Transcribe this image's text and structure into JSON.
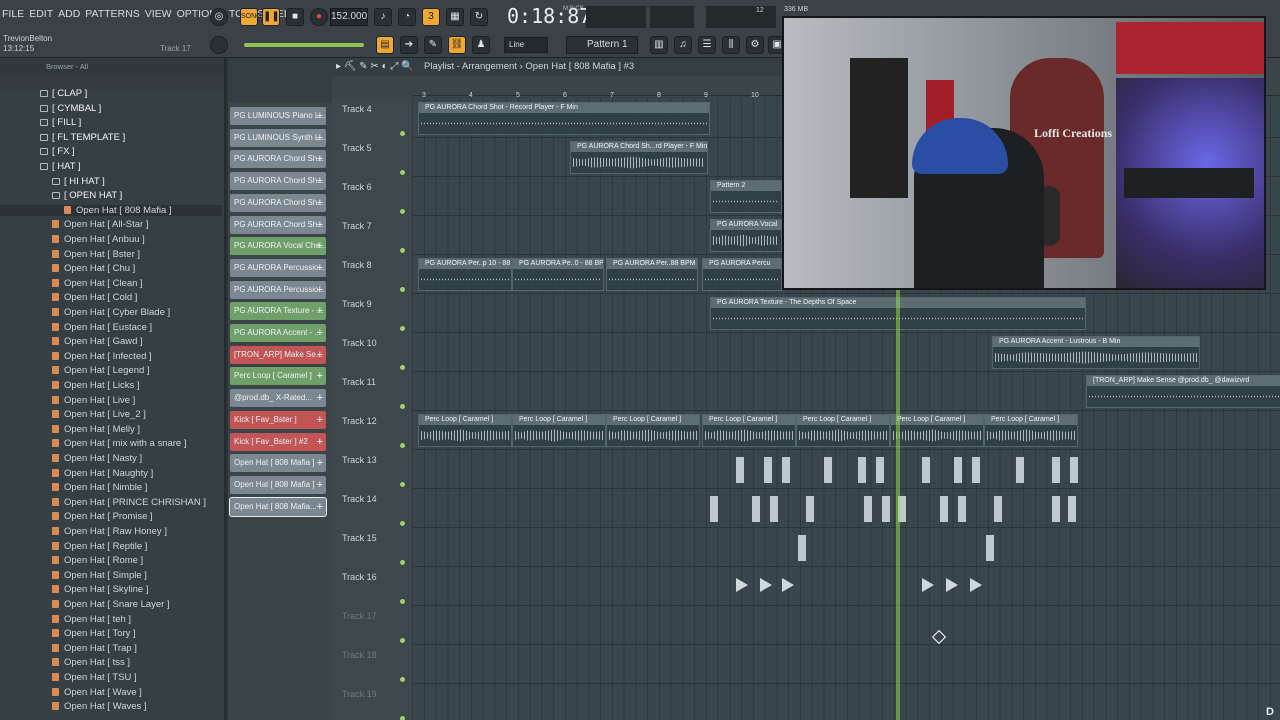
{
  "menu": [
    "FILE",
    "EDIT",
    "ADD",
    "PATTERNS",
    "VIEW",
    "OPTIONS",
    "TOOLS",
    "HELP"
  ],
  "transport": {
    "bpm": "152.000",
    "time": "0:18:87",
    "time_label": "M:S:CS",
    "pattern": "Pattern 1",
    "snap": "Line",
    "memory": "336 MB",
    "cpu": "12"
  },
  "song_info": {
    "user": "TrevionBelton",
    "clock": "13:12:15",
    "track": "Track 17"
  },
  "browser": {
    "title": "Browser - All",
    "items": [
      {
        "label": "[ CLAP ]",
        "kind": "folder",
        "indent": 1
      },
      {
        "label": "[ CYMBAL ]",
        "kind": "folder",
        "indent": 1
      },
      {
        "label": "[ FILL ]",
        "kind": "folder",
        "indent": 1
      },
      {
        "label": "[ FL TEMPLATE ]",
        "kind": "folder",
        "indent": 1
      },
      {
        "label": "[ FX ]",
        "kind": "folder",
        "indent": 1
      },
      {
        "label": "[ HAT ]",
        "kind": "folder",
        "indent": 1
      },
      {
        "label": "[ HI HAT ]",
        "kind": "folder",
        "indent": 2
      },
      {
        "label": "[ OPEN HAT ]",
        "kind": "folder",
        "indent": 2
      },
      {
        "label": "Open Hat [ 808 Mafia ]",
        "kind": "file",
        "indent": 3
      },
      {
        "label": "Open Hat [ All-Star ]",
        "kind": "file",
        "indent": 2
      },
      {
        "label": "Open Hat [ Anbuu ]",
        "kind": "file",
        "indent": 2
      },
      {
        "label": "Open Hat [ Bster ]",
        "kind": "file",
        "indent": 2
      },
      {
        "label": "Open Hat [ Chu ]",
        "kind": "file",
        "indent": 2
      },
      {
        "label": "Open Hat [ Clean ]",
        "kind": "file",
        "indent": 2
      },
      {
        "label": "Open Hat [ Cold ]",
        "kind": "file",
        "indent": 2
      },
      {
        "label": "Open Hat [ Cyber Blade ]",
        "kind": "file",
        "indent": 2
      },
      {
        "label": "Open Hat [ Eustace ]",
        "kind": "file",
        "indent": 2
      },
      {
        "label": "Open Hat [ Gawd ]",
        "kind": "file",
        "indent": 2
      },
      {
        "label": "Open Hat [ Infected ]",
        "kind": "file",
        "indent": 2
      },
      {
        "label": "Open Hat [ Legend ]",
        "kind": "file",
        "indent": 2
      },
      {
        "label": "Open Hat [ Licks ]",
        "kind": "file",
        "indent": 2
      },
      {
        "label": "Open Hat [ Live ]",
        "kind": "file",
        "indent": 2
      },
      {
        "label": "Open Hat [ Live_2 ]",
        "kind": "file",
        "indent": 2
      },
      {
        "label": "Open Hat [ Melly ]",
        "kind": "file",
        "indent": 2
      },
      {
        "label": "Open Hat [ mix with a snare ]",
        "kind": "file",
        "indent": 2
      },
      {
        "label": "Open Hat [ Nasty ]",
        "kind": "file",
        "indent": 2
      },
      {
        "label": "Open Hat [ Naughty ]",
        "kind": "file",
        "indent": 2
      },
      {
        "label": "Open Hat [ Nimble ]",
        "kind": "file",
        "indent": 2
      },
      {
        "label": "Open Hat [ PRINCE CHRISHAN ]",
        "kind": "file",
        "indent": 2
      },
      {
        "label": "Open Hat [ Promise ]",
        "kind": "file",
        "indent": 2
      },
      {
        "label": "Open Hat [ Raw Honey ]",
        "kind": "file",
        "indent": 2
      },
      {
        "label": "Open Hat [ Reptile ]",
        "kind": "file",
        "indent": 2
      },
      {
        "label": "Open Hat [ Rome ]",
        "kind": "file",
        "indent": 2
      },
      {
        "label": "Open Hat [ Simple ]",
        "kind": "file",
        "indent": 2
      },
      {
        "label": "Open Hat [ Skyline ]",
        "kind": "file",
        "indent": 2
      },
      {
        "label": "Open Hat [ Snare Layer ]",
        "kind": "file",
        "indent": 2
      },
      {
        "label": "Open Hat [ teh ]",
        "kind": "file",
        "indent": 2
      },
      {
        "label": "Open Hat [ Tory ]",
        "kind": "file",
        "indent": 2
      },
      {
        "label": "Open Hat [ Trap ]",
        "kind": "file",
        "indent": 2
      },
      {
        "label": "Open Hat [ tss ]",
        "kind": "file",
        "indent": 2
      },
      {
        "label": "Open Hat [ TSU ]",
        "kind": "file",
        "indent": 2
      },
      {
        "label": "Open Hat [ Wave ]",
        "kind": "file",
        "indent": 2
      },
      {
        "label": "Open Hat [ Waves ]",
        "kind": "file",
        "indent": 2
      }
    ]
  },
  "channels": [
    {
      "label": "PG LUMINOUS Piano L...",
      "color": "grey"
    },
    {
      "label": "PG LUMINOUS Synth L...",
      "color": "grey"
    },
    {
      "label": "PG AURORA Chord Sh...",
      "color": "grey"
    },
    {
      "label": "PG AURORA Chord Sh...",
      "color": "grey"
    },
    {
      "label": "PG AURORA Chord Sh...",
      "color": "grey"
    },
    {
      "label": "PG AURORA Chord Sh...",
      "color": "grey"
    },
    {
      "label": "PG AURORA Vocal Cho...",
      "color": "green"
    },
    {
      "label": "PG AURORA Percussio...",
      "color": "grey"
    },
    {
      "label": "PG AURORA Percussio...",
      "color": "grey"
    },
    {
      "label": "PG AURORA Texture - ...",
      "color": "green"
    },
    {
      "label": "PG AURORA Accent - ...",
      "color": "green"
    },
    {
      "label": "[TRON_ARP] Make Se...",
      "color": "red"
    },
    {
      "label": "Perc Loop [ Caramel ]",
      "color": "green"
    },
    {
      "label": "@prod.db_ X-Rated...",
      "color": "grey"
    },
    {
      "label": "Kick [ Fav_Bster ]",
      "color": "red"
    },
    {
      "label": "Kick [ Fav_Bster ] #2",
      "color": "red"
    },
    {
      "label": "Open Hat [ 808 Mafia ]",
      "color": "grey"
    },
    {
      "label": "Open Hat [ 808 Mafia ]",
      "color": "grey"
    },
    {
      "label": "Open Hat [ 808 Mafia...",
      "color": "grey",
      "selected": true
    }
  ],
  "playlist": {
    "title": "Playlist - Arrangement",
    "pattern": "Open Hat [ 808 Mafia ] #3",
    "ruler_numbers": [
      "3",
      "4",
      "5",
      "6",
      "7",
      "8",
      "9",
      "10"
    ],
    "tracks": [
      "Track 4",
      "Track 5",
      "Track 6",
      "Track 7",
      "Track 8",
      "Track 9",
      "Track 10",
      "Track 11",
      "Track 12",
      "Track 13",
      "Track 14",
      "Track 15",
      "Track 16",
      "Track 17",
      "Track 18",
      "Track 19"
    ],
    "clips": [
      {
        "row": 0,
        "label": "PG AURORA Chord Shot - Record Player - F Min",
        "wave": "thin"
      },
      {
        "row": 1,
        "label": "PG AURORA Chord Sh...rd Player - F Min #2",
        "wave": "thick"
      },
      {
        "row": 2,
        "label": "Pattern 2",
        "wave": "thin"
      },
      {
        "row": 3,
        "label": "PG AURORA Vocal",
        "wave": "thick"
      },
      {
        "row": 4,
        "label": "PG AURORA Per..p 10 - 88 BPM",
        "wave": "thin"
      },
      {
        "row": 4,
        "label": "PG AURORA Pe..0 - 88 BPM",
        "wave": "thin"
      },
      {
        "row": 4,
        "label": "PG AURORA Per..88 BPM #2",
        "wave": "thin"
      },
      {
        "row": 4,
        "label": "PG AURORA Percu",
        "wave": "thin"
      },
      {
        "row": 5,
        "label": "PG AURORA Texture - The Depths Of Space",
        "wave": "thin"
      },
      {
        "row": 6,
        "label": "PG AURORA Accent - Lustrous - B Min",
        "wave": "thick"
      },
      {
        "row": 7,
        "label": "[TRON_ARP] Make Sense @prod.db_ @dawizvrd",
        "wave": "thin"
      },
      {
        "row": 8,
        "label": "Perc Loop [ Caramel ]",
        "wave": "thick"
      },
      {
        "row": 8,
        "label": "Perc Loop [ Caramel ]",
        "wave": "thick"
      },
      {
        "row": 8,
        "label": "Perc Loop [ Caramel ]",
        "wave": "thick"
      },
      {
        "row": 8,
        "label": "Perc Loop [ Caramel ]",
        "wave": "thick"
      },
      {
        "row": 8,
        "label": "Perc Loop [ Caramel ]",
        "wave": "thick"
      },
      {
        "row": 8,
        "label": "Perc Loop [ Caramel ]",
        "wave": "thick"
      },
      {
        "row": 8,
        "label": "Perc Loop [ Caramel ]",
        "wave": "thick"
      }
    ]
  },
  "webcam": {
    "shirt_text": "Loffi Creations"
  },
  "watermark": "D"
}
